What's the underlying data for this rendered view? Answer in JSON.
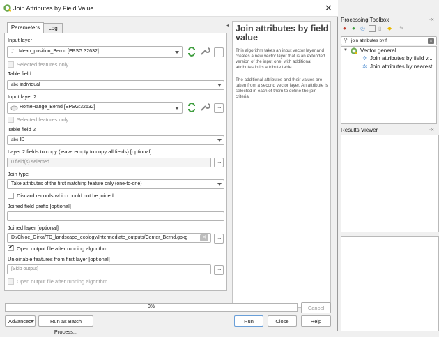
{
  "dialog": {
    "title": "Join Attributes by Field Value",
    "tabs": {
      "parameters": "Parameters",
      "log": "Log"
    },
    "input_layer": {
      "label": "Input layer",
      "value": "Mean_position_Bernd [EPSG:32632]"
    },
    "selected_features_1": "Selected features only",
    "table_field": {
      "label": "Table field",
      "type": "abc",
      "value": "individual"
    },
    "input_layer_2": {
      "label": "Input layer 2",
      "value": "HomeRange_Bernd [EPSG:32632]"
    },
    "selected_features_2": "Selected features only",
    "table_field_2": {
      "label": "Table field 2",
      "type": "abc",
      "value": "ID"
    },
    "fields_to_copy": {
      "label": "Layer 2 fields to copy (leave empty to copy all fields) [optional]",
      "value": "0 field(s) selected",
      "button": "..."
    },
    "join_type": {
      "label": "Join type",
      "value": "Take attributes of the first matching feature only (one-to-one)"
    },
    "discard_label": "Discard records which could not be joined",
    "prefix_label": "Joined field prefix [optional]",
    "joined_layer": {
      "label": "Joined layer [optional]",
      "value": "D:/Chloe_Girka/TD_landscape_ecology/Intermediate_outputs/Center_Bernd.gpkg"
    },
    "open_output_label": "Open output file after running algorithm",
    "unjoinable": {
      "label": "Unjoinable features from first layer [optional]",
      "placeholder": "[Skip output]"
    },
    "open_output_label_2": "Open output file after running algorithm",
    "help_title": "Join attributes by field value",
    "help_p1": "This algorithm takes an input vector layer and creates a new vector layer that is an extended version of the input one, with additional attributes in its attribute table.",
    "help_p2": "The additional attributes and their values are taken from a second vector layer. An attribute is selected in each of them to define the join criteria.",
    "progress": {
      "text": "0%",
      "value": 0
    },
    "buttons": {
      "cancel": "Cancel",
      "advanced": "Advanced",
      "batch": "Run as Batch Process...",
      "run": "Run",
      "close": "Close",
      "help": "Help"
    },
    "dots": "..."
  },
  "toolbox": {
    "title": "Processing Toolbox",
    "search_value": "join attributes by fi",
    "group": "Vector general",
    "items": [
      "Join attributes by field v...",
      "Join attributes by nearest"
    ]
  },
  "results": {
    "title": "Results Viewer"
  },
  "colors": {
    "qgis_green": "#6aa84f",
    "gear_blue": "#6a9fd8",
    "accent": "#1a1a1a"
  }
}
